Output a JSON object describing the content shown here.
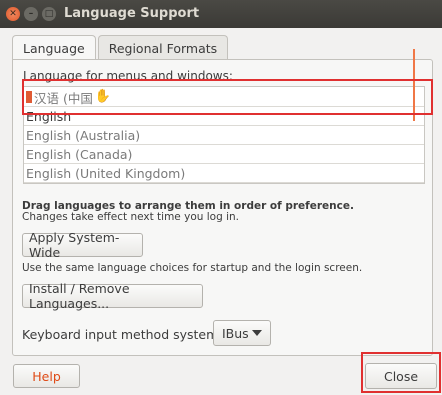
{
  "window": {
    "title": "Language Support"
  },
  "tabs": [
    {
      "label": "Language",
      "active": true
    },
    {
      "label": "Regional Formats",
      "active": false
    }
  ],
  "language": {
    "section_label": "Language for menus and windows:",
    "items": [
      {
        "label": "汉语 (中国"
      },
      {
        "label": "English"
      },
      {
        "label": "English (Australia)"
      },
      {
        "label": "English (Canada)"
      },
      {
        "label": "English (United Kingdom)"
      }
    ],
    "drag_hint_bold": "Drag languages to arrange them in order of preference.",
    "drag_hint": "Changes take effect next time you log in.",
    "apply_label": "Apply System-Wide",
    "apply_hint": "Use the same language choices for startup and the login screen.",
    "install_label": "Install / Remove Languages...",
    "keyboard_label": "Keyboard input method system:",
    "keyboard_value": "IBus"
  },
  "footer": {
    "help_label": "Help",
    "close_label": "Close"
  },
  "colors": {
    "accent": "#e05b34",
    "highlight": "#e03030"
  }
}
